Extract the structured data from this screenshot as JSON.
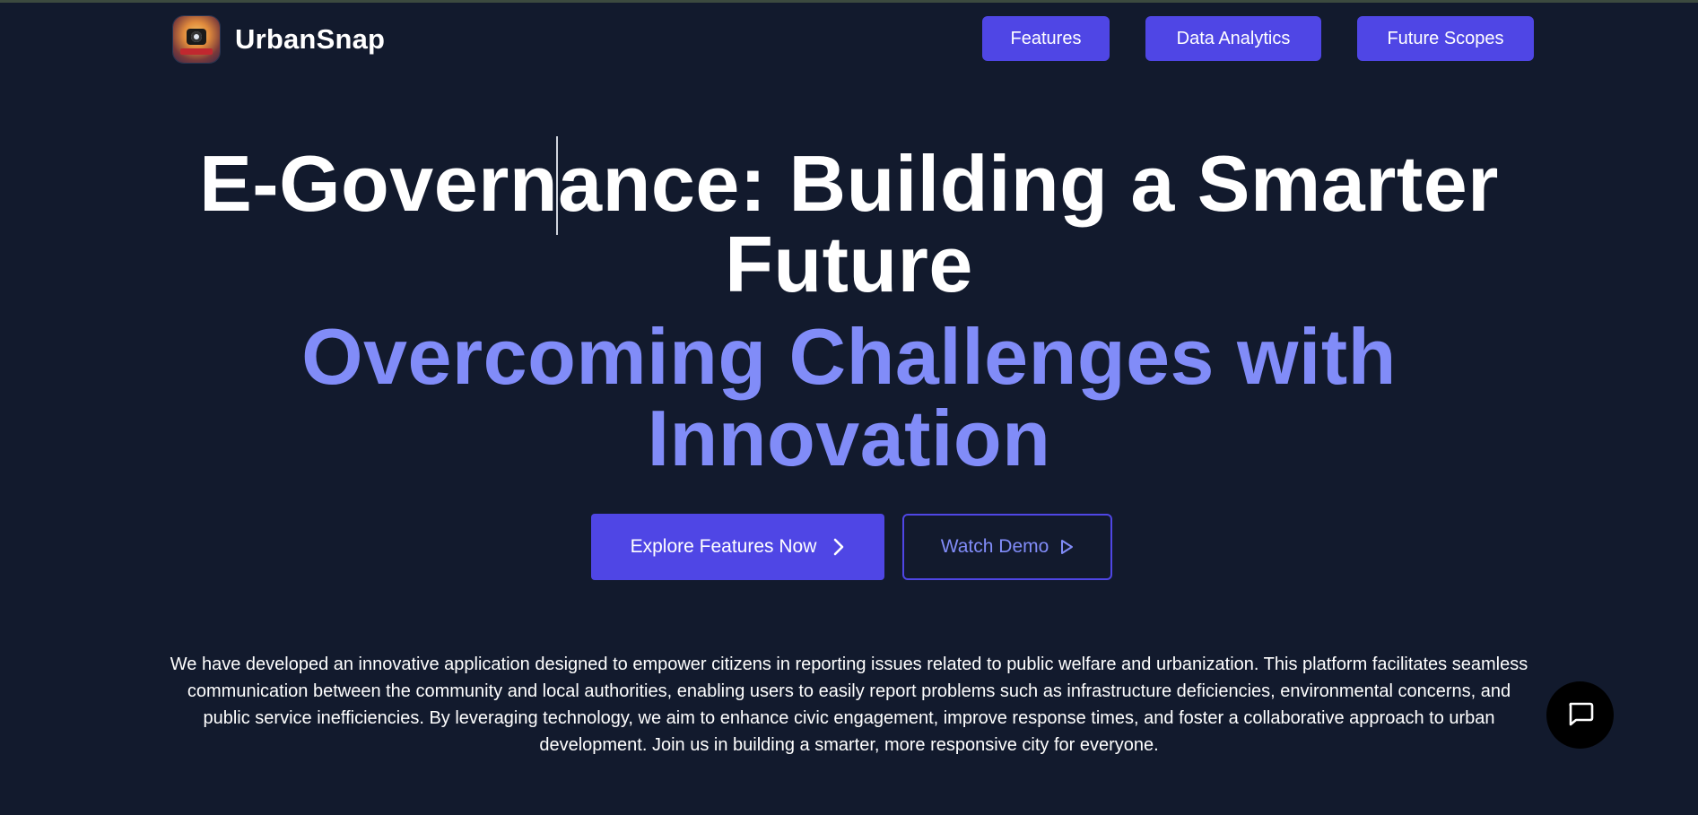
{
  "brand": {
    "name": "UrbanSnap",
    "logo_icon": "urbansnap-camera-logo"
  },
  "nav": {
    "items": [
      {
        "label": "Features"
      },
      {
        "label": "Data Analytics"
      },
      {
        "label": "Future Scopes"
      }
    ]
  },
  "hero": {
    "title": "E-Governance: Building a Smarter Future",
    "subtitle": "Overcoming Challenges with Innovation"
  },
  "cta": {
    "primary_label": "Explore Features Now",
    "primary_icon": "chevron-right-icon",
    "secondary_label": "Watch Demo",
    "secondary_icon": "play-icon"
  },
  "description": "We have developed an innovative application designed to empower citizens in reporting issues related to public welfare and urbanization. This platform facilitates seamless communication between the community and local authorities, enabling users to easily report problems such as infrastructure deficiencies, environmental concerns, and public service inefficiencies. By leveraging technology, we aim to enhance civic engagement, improve response times, and foster a collaborative approach to urban development. Join us in building a smarter, more responsive city for everyone.",
  "chat": {
    "icon": "chat-bubble-icon"
  },
  "colors": {
    "background": "#121a2d",
    "accent": "#4f46e5",
    "accent_light": "#818cf8",
    "text": "#ffffff"
  }
}
